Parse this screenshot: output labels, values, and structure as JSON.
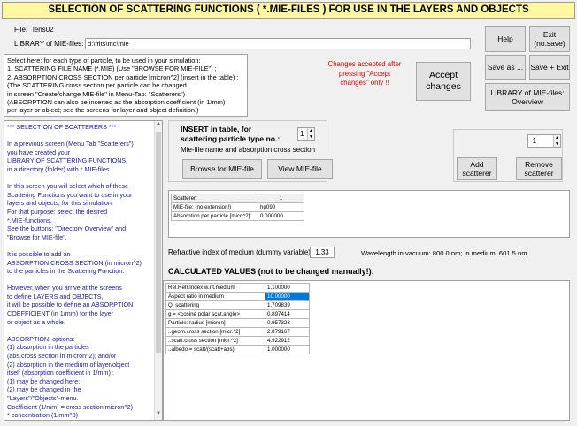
{
  "title": "SELECTION OF SCATTERING FUNCTIONS ( *.MIE-FILES ) FOR USE IN THE LAYERS AND OBJECTS",
  "file_label": "File:",
  "file_name": "lens02",
  "library_label": "LIBRARY of MIE-files:",
  "library_path": "d:\\frits\\mc\\mie",
  "buttons": {
    "help": "Help",
    "exit": "Exit\n(no.save)",
    "save_as": "Save as ...",
    "save_exit": "Save + Exit",
    "accept": "Accept\nchanges",
    "library_overview": "LIBRARY of MIE-files:\nOverview",
    "browse": "Browse for MIE-file",
    "view": "View MIE-file",
    "add_scatterer": "Add\nscatterer",
    "remove_scatterer": "Remove\nscatterer"
  },
  "changes_note": "Changes accepted after\npressing \"Accept\nchanges\" only !!",
  "instructions": [
    "Select here: for each type of particle, to be used in your simulation:",
    "1. SCATTERING FILE NAME (*.MIE)   (Use  \"BROWSE FOR MIE-FILE\") ;",
    "2. ABSORPTION CROSS SECTION per particle  [micron^2]   (insert in the table) ;",
    "    (The SCATTERING cross section per particle can be changed",
    "     in screen \"Create/change MIE-file\" in Menu-Tab: \"Scatterers\")",
    "    (ABSORPTION can also be inserted as the absorption coefficient (in 1/mm)",
    "     per layer or object; see the screens for layer and object definition.)"
  ],
  "help_text": [
    "***  SELECTION OF SCATTERERS  ***",
    "",
    "In a previous screen (Menu Tab \"Scatterers\")",
    "you have created your",
    "LIBRARY OF SCATTERING FUNCTIONS,",
    "in a directory (folder) with  *.MIE-files.",
    "",
    "In this screen you will select which of these",
    "Scattering Functions you want to use in your",
    "layers and objects, for this simulation.",
    "For that purpose:  select the desired",
    "*.MIE-functions.",
    "See the buttons: \"Directory Overview\" and",
    "\"Browse for MIE-file\".",
    "",
    "It is possible to add an",
    "ABSORPTION CROSS SECTION (in micron^2)",
    "to the particles in the Scattering Function.",
    "",
    "However, when you arrive at the screens",
    "to define LAYERS and OBJECTS,",
    "it will be possible to define an ABSORPTION",
    "COEFFICIENT (in 1/mm) for the layer",
    "or object as a whole.",
    "",
    "ABSORPTION: options:",
    "(1) absorption in the particles",
    "     (abs.cross section in micron^2); and/or",
    "(2) absorption in the medium of  layer/object",
    "     itself (absorption coefficient in 1/mm) :",
    "     (1) may be changed here;",
    "     (2) may be changed in the",
    "          \"Layers\"/\"Objects\"-menu.",
    "Coefficient (1/mm) = cross section micron^2)",
    "           * concentration (1/mm^3)"
  ],
  "insert": {
    "heading": "INSERT in table, for\nscattering particle type no.:",
    "subtext": "Mie-file name and absorption cross section",
    "type_no": "1"
  },
  "scatterer_spin": "-1",
  "scatterer_table": {
    "rows": [
      {
        "label": "Scatterer:",
        "value": "1"
      },
      {
        "label": "MIE-file: (no extension!)",
        "value": "hg090"
      },
      {
        "label": "Absorption per particle [micr.^2]:",
        "value": "0.000000"
      }
    ]
  },
  "refractive_label": "Refractive index of medium (dummy variable):",
  "refractive_value": "1.33",
  "wavelength_text": "Wavelength in vacuum:  800.0 nm;  in medium:  601.5 nm",
  "calculated_heading": "CALCULATED VALUES  (not to be changed manually!):",
  "calculated_table": [
    {
      "label": "Rel.Refr.Index w.r.t.medium",
      "value": "1.100000"
    },
    {
      "label": "Aspect ratio in medium",
      "value": "10.00000",
      "selected": true
    },
    {
      "label": "Q_scattering",
      "value": "1.709839"
    },
    {
      "label": "g = <cosine polar scat.angle>",
      "value": "0.897414"
    },
    {
      "label": "Particle:  radius [micron]",
      "value": "0.957323"
    },
    {
      "label": "..geom.cross section [micr.^2]",
      "value": "2.879167"
    },
    {
      "label": "..scatt.cross section [micr.^2]",
      "value": "4.922912"
    },
    {
      "label": "..albedo = scatt/(scatt+abs)",
      "value": "1.000000"
    }
  ],
  "colors": {
    "title_bg": "#fff8a0",
    "help_text": "#1a1aa6",
    "note_text": "#e00000",
    "selected_cell": "#0078d7"
  }
}
